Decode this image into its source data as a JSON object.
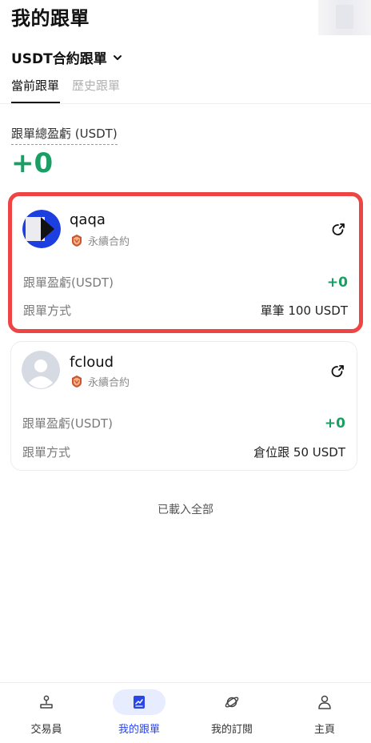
{
  "header": {
    "title": "我的跟單"
  },
  "contract_selector": {
    "label": "USDT合約跟單"
  },
  "tabs": [
    {
      "label": "當前跟單",
      "active": true
    },
    {
      "label": "歷史跟單",
      "active": false
    }
  ],
  "summary": {
    "label": "跟單總盈虧 (USDT)",
    "value": "+0"
  },
  "cards": [
    {
      "name": "qaqa",
      "tag": "永續合約",
      "pnl_label": "跟單盈虧(USDT)",
      "pnl_value": "+0",
      "mode_label": "跟單方式",
      "mode_value": "單筆 100 USDT",
      "highlighted": true
    },
    {
      "name": "fcloud",
      "tag": "永續合約",
      "pnl_label": "跟單盈虧(USDT)",
      "pnl_value": "+0",
      "mode_label": "跟單方式",
      "mode_value": "倉位跟 50 USDT",
      "highlighted": false
    }
  ],
  "list_footer": "已載入全部",
  "bottom_nav": [
    {
      "label": "交易員",
      "icon": "trader-icon",
      "active": false
    },
    {
      "label": "我的跟單",
      "icon": "copy-trade-icon",
      "active": true
    },
    {
      "label": "我的訂閱",
      "icon": "planet-icon",
      "active": false
    },
    {
      "label": "主頁",
      "icon": "profile-icon",
      "active": false
    }
  ],
  "colors": {
    "profit_green": "#1a9e63",
    "highlight_red": "#ee4444",
    "accent_blue": "#2a45e8"
  }
}
